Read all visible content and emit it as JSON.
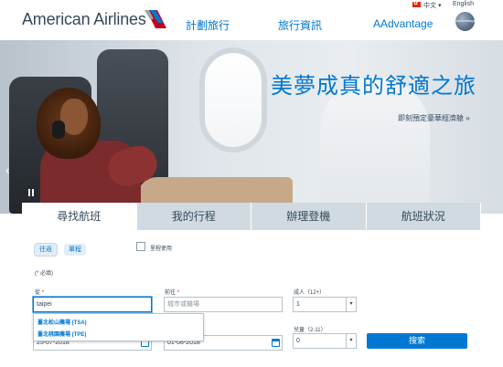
{
  "header": {
    "logo_text": "American Airlines",
    "nav": [
      {
        "label": "計劃旅行"
      },
      {
        "label": "旅行資訊"
      },
      {
        "label": "AAdvantage"
      }
    ],
    "language_selected": "中文 ▾",
    "language_alt": "English",
    "badge_text": "AAdvantage"
  },
  "hero": {
    "title": "美夢成真的舒適之旅",
    "subtitle": "即刻預定豪華經濟艙 »"
  },
  "tabs": [
    {
      "label": "尋找航班",
      "active": true
    },
    {
      "label": "我的行程",
      "active": false
    },
    {
      "label": "辦理登機",
      "active": false
    },
    {
      "label": "航班狀況",
      "active": false
    }
  ],
  "form": {
    "trip_types": [
      "往返",
      "單程"
    ],
    "miles_label": "里程使用",
    "required_note": "必填",
    "from_label": "從",
    "from_value": "taipei",
    "to_label": "前往",
    "to_placeholder": "城市或機場",
    "adults_label": "成人（12+）",
    "adults_value": "1",
    "children_label": "兒童（2-11）",
    "children_value": "0",
    "depart_date": "25-07-2018",
    "return_date": "01-08-2018",
    "suggestions": [
      "臺北松山機場 (TSA)",
      "臺北桃園機場 (TPE)"
    ],
    "search_label": "搜索"
  },
  "colors": {
    "brand_blue": "#0078d2",
    "text_dark": "#36495a",
    "tab_inactive": "#d0dae0",
    "required_red": "#d3153a"
  }
}
